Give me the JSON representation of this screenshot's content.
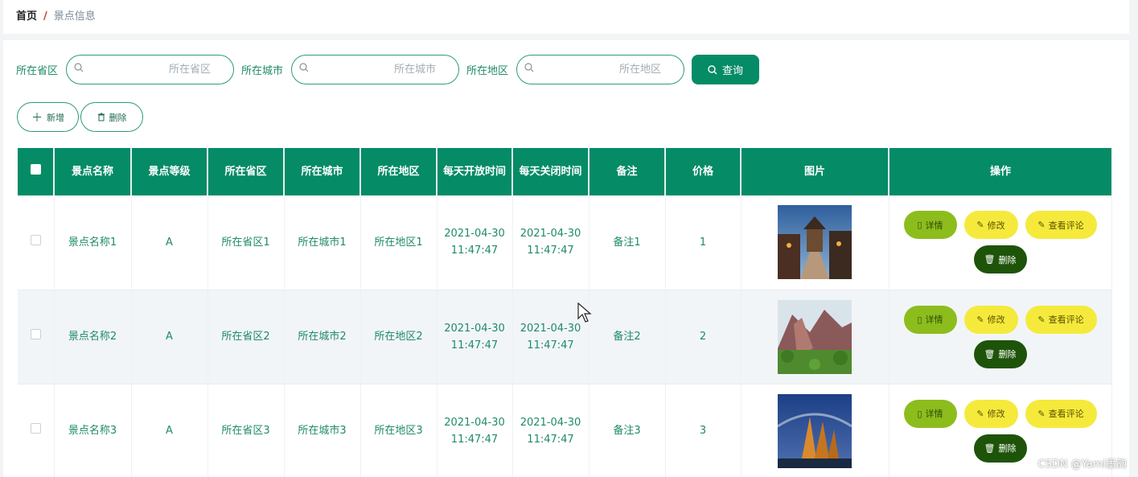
{
  "breadcrumb": {
    "home": "首页",
    "separator": "/",
    "current": "景点信息"
  },
  "filters": [
    {
      "label": "所在省区",
      "placeholder": "所在省区",
      "value": ""
    },
    {
      "label": "所在城市",
      "placeholder": "所在城市",
      "value": ""
    },
    {
      "label": "所在地区",
      "placeholder": "所在地区",
      "value": ""
    }
  ],
  "query_label": "查询",
  "actions": {
    "add_label": "新增",
    "delete_label": "删除"
  },
  "table": {
    "headers": [
      "景点名称",
      "景点等级",
      "所在省区",
      "所在城市",
      "所在地区",
      "每天开放时间",
      "每天关闭时间",
      "备注",
      "价格",
      "图片",
      "操作"
    ],
    "rows": [
      {
        "name": "景点名称1",
        "level": "A",
        "province": "所在省区1",
        "city": "所在城市1",
        "district": "所在地区1",
        "open_date": "2021-04-30",
        "open_time": "11:47:47",
        "close_date": "2021-04-30",
        "close_time": "11:47:47",
        "remark": "备注1",
        "price": "1",
        "image": "town-street-photo"
      },
      {
        "name": "景点名称2",
        "level": "A",
        "province": "所在省区2",
        "city": "所在城市2",
        "district": "所在地区2",
        "open_date": "2021-04-30",
        "open_time": "11:47:47",
        "close_date": "2021-04-30",
        "close_time": "11:47:47",
        "remark": "备注2",
        "price": "2",
        "image": "mountain-cliff-photo"
      },
      {
        "name": "景点名称3",
        "level": "A",
        "province": "所在省区3",
        "city": "所在城市3",
        "district": "所在地区3",
        "open_date": "2021-04-30",
        "open_time": "11:47:47",
        "close_date": "2021-04-30",
        "close_time": "11:47:47",
        "remark": "备注3",
        "price": "3",
        "image": "bridge-sails-photo"
      }
    ],
    "row_actions": {
      "detail": "详情",
      "edit": "修改",
      "comments": "查看评论",
      "remove": "删除"
    }
  },
  "colors": {
    "primary": "#058b66",
    "detail_btn": "#8cbd1c",
    "edit_btn": "#f5ea3c",
    "remove_btn": "#1e5409"
  },
  "watermark": "CSDN @Yaml墨韵"
}
